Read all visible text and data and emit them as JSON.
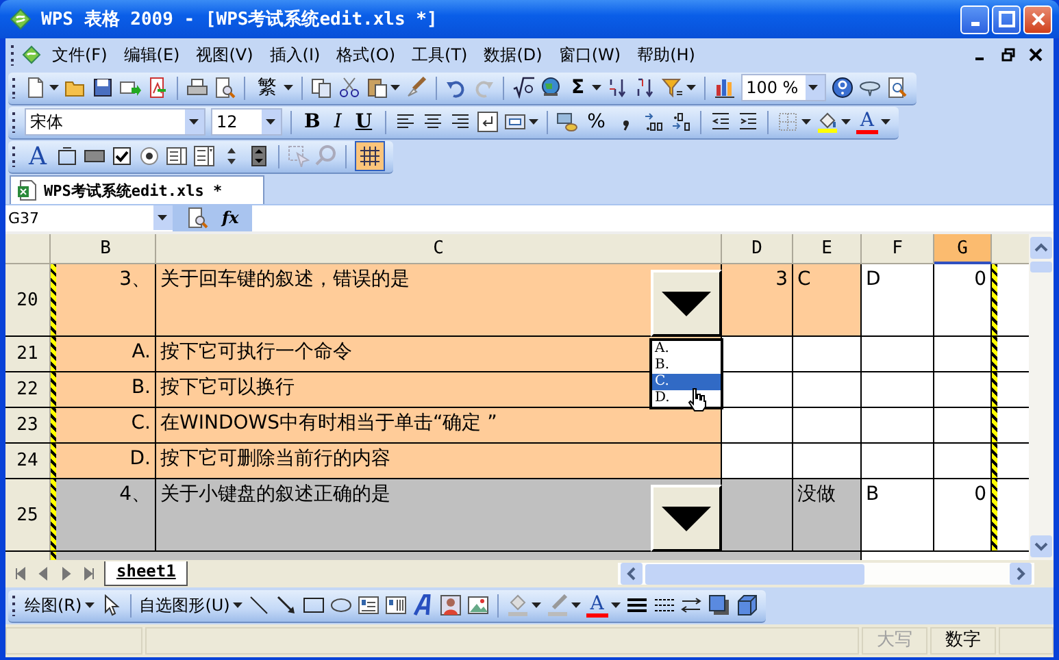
{
  "window": {
    "title": "WPS 表格 2009 - [WPS考试系统edit.xls *]"
  },
  "menu": [
    {
      "label": "文件(F)"
    },
    {
      "label": "编辑(E)"
    },
    {
      "label": "视图(V)"
    },
    {
      "label": "插入(I)"
    },
    {
      "label": "格式(O)"
    },
    {
      "label": "工具(T)"
    },
    {
      "label": "数据(D)"
    },
    {
      "label": "窗口(W)"
    },
    {
      "label": "帮助(H)"
    }
  ],
  "standard_toolbar": {
    "traditional": "繁",
    "sum": "Σ",
    "zoom": "100 %"
  },
  "format_toolbar": {
    "font": "宋体",
    "size": "12",
    "bold": "B",
    "italic": "I",
    "underline": "U",
    "percent": "%",
    "font_color": "A"
  },
  "forms_toolbar": {
    "label_tool": "A",
    "grid_on": true
  },
  "document_tabs": [
    {
      "label": "WPS考试系统edit.xls *",
      "selected": true
    }
  ],
  "formula_bar": {
    "name_box": "G37",
    "function": "fx"
  },
  "sheet": {
    "columns": [
      {
        "label": "B",
        "selected": false
      },
      {
        "label": "C",
        "selected": false
      },
      {
        "label": "D",
        "selected": false
      },
      {
        "label": "E",
        "selected": false
      },
      {
        "label": "F",
        "selected": false
      },
      {
        "label": "G",
        "selected": true
      }
    ],
    "rows": [
      {
        "number": "20",
        "kind": "question",
        "answered": true,
        "b": "3、",
        "c": "关于回车键的叙述，错误的是",
        "d": "3",
        "e": "C",
        "f": "D",
        "g": "0"
      },
      {
        "number": "21",
        "kind": "option",
        "b": "A.",
        "c": "按下它可执行一个命令"
      },
      {
        "number": "22",
        "kind": "option",
        "b": "B.",
        "c": "按下它可以换行"
      },
      {
        "number": "23",
        "kind": "option",
        "b": "C.",
        "c": "在WINDOWS中有时相当于单击“确定 ”"
      },
      {
        "number": "24",
        "kind": "option",
        "b": "D.",
        "c": "按下它可删除当前行的内容"
      },
      {
        "number": "25",
        "kind": "question",
        "answered": false,
        "b": "4、",
        "c": "关于小键盘的叙述正确的是",
        "e": "没做",
        "f": "B",
        "g": "0"
      }
    ]
  },
  "dropdown": {
    "items": [
      {
        "label": "A.",
        "selected": false
      },
      {
        "label": "B.",
        "selected": false
      },
      {
        "label": "C.",
        "selected": true
      },
      {
        "label": "D.",
        "selected": false
      }
    ]
  },
  "sheet_tabs": [
    {
      "label": "sheet1",
      "selected": true
    }
  ],
  "drawing_toolbar": {
    "draw": "绘图(R)",
    "autoshapes": "自选图形(U)",
    "font_color": "A"
  },
  "status_bar": [
    {
      "label": "大写",
      "disabled": true
    },
    {
      "label": "数字",
      "disabled": false
    }
  ]
}
